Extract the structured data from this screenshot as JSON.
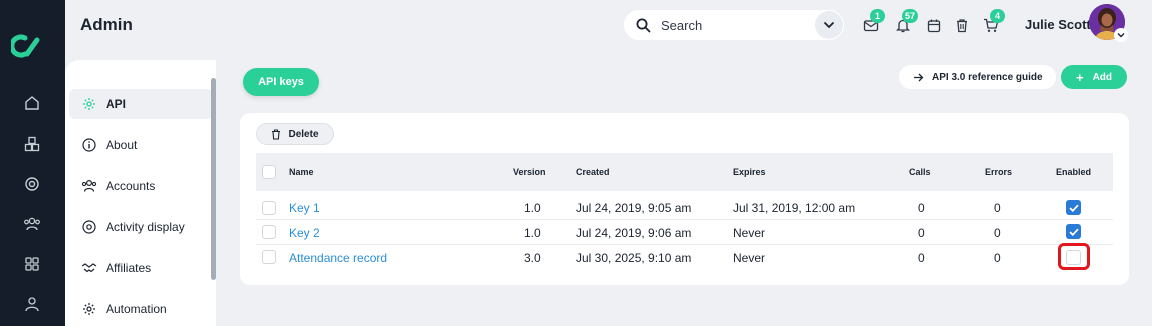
{
  "app": {
    "title": "Admin"
  },
  "header": {
    "search_label": "Search",
    "icons": [
      {
        "name": "mail-icon",
        "badge": "1"
      },
      {
        "name": "bell-icon",
        "badge": "57"
      },
      {
        "name": "calendar-icon",
        "badge": ""
      },
      {
        "name": "trash-icon",
        "badge": ""
      },
      {
        "name": "cart-icon",
        "badge": "4"
      }
    ],
    "user_name": "Julie Scott"
  },
  "rail": {
    "items": [
      "home-icon",
      "boxes-icon",
      "target-icon",
      "users-icon",
      "grid-icon",
      "user-icon"
    ]
  },
  "sidebar": {
    "items": [
      {
        "label": "API",
        "icon": "gear-icon",
        "active": true
      },
      {
        "label": "About",
        "icon": "info-icon",
        "active": false
      },
      {
        "label": "Accounts",
        "icon": "users-icon",
        "active": false
      },
      {
        "label": "Activity display",
        "icon": "target-icon",
        "active": false
      },
      {
        "label": "Affiliates",
        "icon": "handshake-icon",
        "active": false
      },
      {
        "label": "Automation",
        "icon": "gear-icon",
        "active": false
      }
    ]
  },
  "main": {
    "tab_label": "API keys",
    "ref_guide_label": "API 3.0 reference guide",
    "add_label": "Add",
    "delete_label": "Delete",
    "columns": [
      "Name",
      "Version",
      "Created",
      "Expires",
      "Calls",
      "Errors",
      "Enabled"
    ],
    "rows": [
      {
        "name": "Key 1",
        "version": "1.0",
        "created": "Jul 24, 2019, 9:05 am",
        "expires": "Jul 31, 2019, 12:00 am",
        "calls": "0",
        "errors": "0",
        "enabled": true
      },
      {
        "name": "Key 2",
        "version": "1.0",
        "created": "Jul 24, 2019, 9:06 am",
        "expires": "Never",
        "calls": "0",
        "errors": "0",
        "enabled": true
      },
      {
        "name": "Attendance record",
        "version": "3.0",
        "created": "Jul 30, 2025, 9:10 am",
        "expires": "Never",
        "calls": "0",
        "errors": "0",
        "enabled": false
      }
    ]
  },
  "colors": {
    "accent": "#2bcf98",
    "rail": "#161d2a",
    "link": "#2b8fd6",
    "checkbox": "#2a7ad7",
    "highlight": "#e3161d"
  }
}
